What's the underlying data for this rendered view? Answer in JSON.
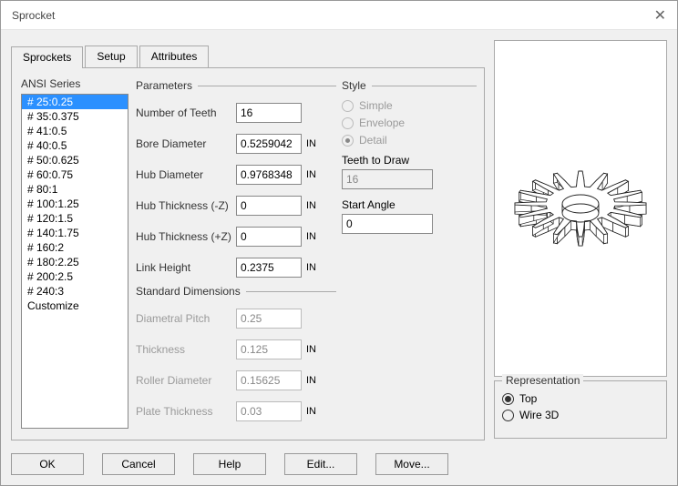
{
  "window": {
    "title": "Sprocket"
  },
  "tabs": {
    "sprockets": "Sprockets",
    "setup": "Setup",
    "attributes": "Attributes"
  },
  "series": {
    "label": "ANSI Series",
    "items": [
      "# 25:0.25",
      "# 35:0.375",
      "# 41:0.5",
      "# 40:0.5",
      "# 50:0.625",
      "# 60:0.75",
      "# 80:1",
      "# 100:1.25",
      "# 120:1.5",
      "# 140:1.75",
      "# 160:2",
      "# 180:2.25",
      "# 200:2.5",
      "# 240:3",
      "Customize"
    ],
    "selected": 0
  },
  "params": {
    "header": "Parameters",
    "teeth": {
      "label": "Number of Teeth",
      "value": "16"
    },
    "bore": {
      "label": "Bore Diameter",
      "value": "0.5259042",
      "unit": "IN"
    },
    "hubd": {
      "label": "Hub Diameter",
      "value": "0.9768348",
      "unit": "IN"
    },
    "hubtn": {
      "label": "Hub Thickness (-Z)",
      "value": "0",
      "unit": "IN"
    },
    "hubtp": {
      "label": "Hub Thickness (+Z)",
      "value": "0",
      "unit": "IN"
    },
    "link": {
      "label": "Link Height",
      "value": "0.2375",
      "unit": "IN"
    }
  },
  "std": {
    "header": "Standard Dimensions",
    "pitch": {
      "label": "Diametral Pitch",
      "value": "0.25"
    },
    "thick": {
      "label": "Thickness",
      "value": "0.125",
      "unit": "IN"
    },
    "roller": {
      "label": "Roller Diameter",
      "value": "0.15625",
      "unit": "IN"
    },
    "plate": {
      "label": "Plate Thickness",
      "value": "0.03",
      "unit": "IN"
    }
  },
  "style": {
    "header": "Style",
    "simple": "Simple",
    "envelope": "Envelope",
    "detail": "Detail",
    "teeth_label": "Teeth to Draw",
    "teeth_value": "16",
    "start_label": "Start Angle",
    "start_value": "0"
  },
  "rep": {
    "header": "Representation",
    "top": "Top",
    "wire": "Wire 3D"
  },
  "buttons": {
    "ok": "OK",
    "cancel": "Cancel",
    "help": "Help",
    "edit": "Edit...",
    "move": "Move..."
  }
}
